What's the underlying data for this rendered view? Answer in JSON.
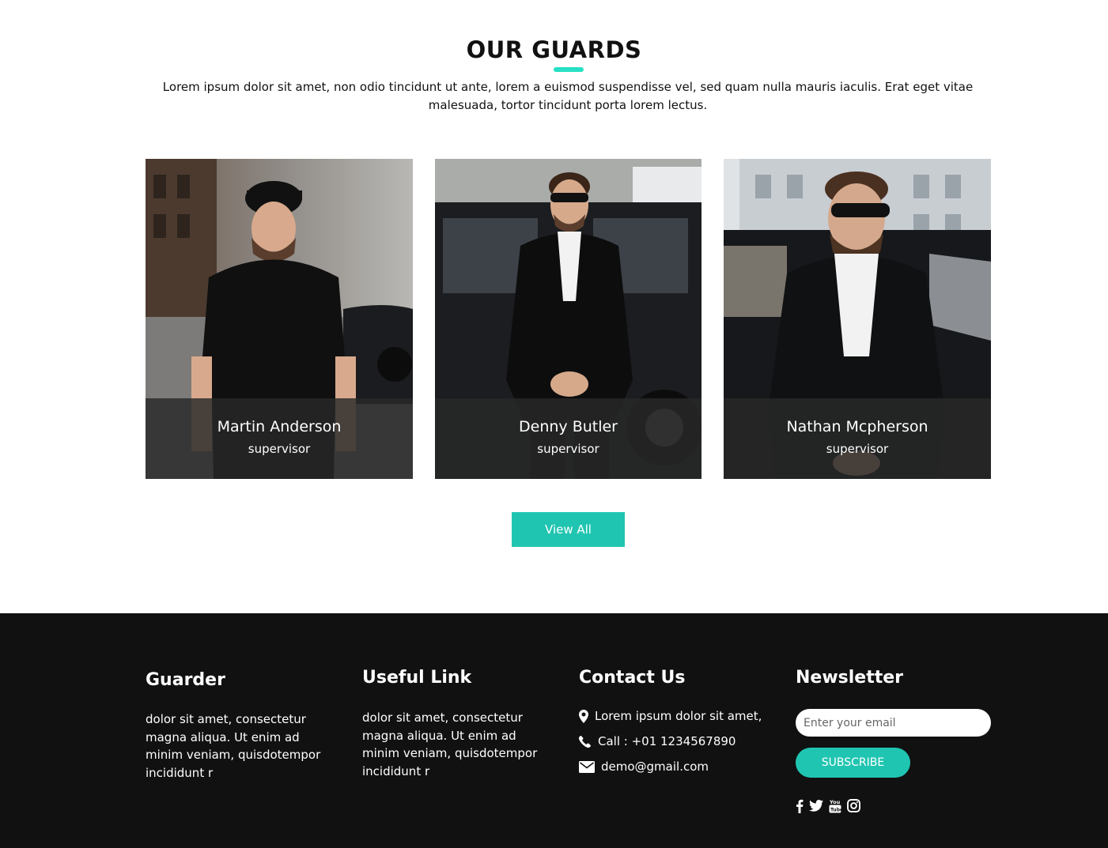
{
  "guards": {
    "title": "OUR GUARDS",
    "intro": "Lorem ipsum dolor sit amet, non odio tincidunt ut ante, lorem a euismod suspendisse vel, sed quam nulla mauris iaculis. Erat eget vitae malesuada, tortor tincidunt porta lorem lectus.",
    "cards": [
      {
        "name": "Martin Anderson",
        "role": "supervisor"
      },
      {
        "name": "Denny Butler",
        "role": "supervisor"
      },
      {
        "name": "Nathan Mcpherson",
        "role": "supervisor"
      }
    ],
    "view_all_label": "View All"
  },
  "footer": {
    "brand": "Guarder",
    "brand_text": "dolor sit amet, consectetur magna aliqua. Ut enim ad minim veniam, quisdotempor incididunt r",
    "useful_link": {
      "heading": "Useful Link",
      "text": "dolor sit amet, consectetur magna aliqua. Ut enim ad minim veniam, quisdotempor incididunt r"
    },
    "contact": {
      "heading": "Contact Us",
      "address": "Lorem ipsum dolor sit amet,",
      "phone": "Call : +01 1234567890",
      "email": "demo@gmail.com"
    },
    "newsletter": {
      "heading": "Newsletter",
      "placeholder": "Enter your email",
      "subscribe_label": "SUBSCRIBE",
      "social_icons": [
        "facebook-icon",
        "twitter-icon",
        "youtube-icon",
        "instagram-icon"
      ]
    }
  },
  "colors": {
    "accent": "#20c5b1",
    "underline": "#27e0c4",
    "footer_bg": "#111111"
  }
}
